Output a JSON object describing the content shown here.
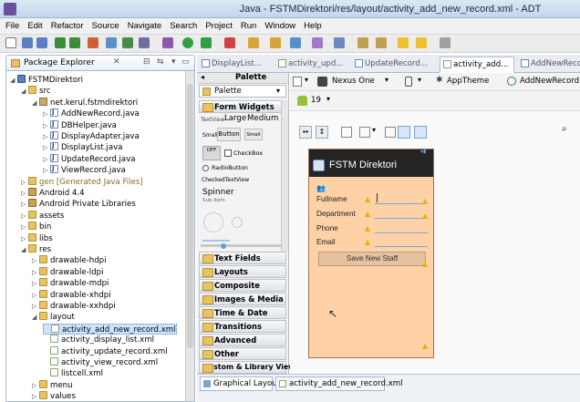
{
  "window": {
    "title": "Java - FSTMDirektori/res/layout/activity_add_new_record.xml - ADT"
  },
  "menu": [
    "File",
    "Edit",
    "Refactor",
    "Source",
    "Navigate",
    "Search",
    "Project",
    "Run",
    "Window",
    "Help"
  ],
  "package_explorer": {
    "title": "Package Explorer",
    "tree": [
      {
        "label": "FSTMDirektori",
        "icon": "project-icon",
        "depth": 0,
        "expanded": true
      },
      {
        "label": "src",
        "icon": "folder-icon",
        "depth": 1,
        "expanded": true
      },
      {
        "label": "net.kerul.fstmdirektori",
        "icon": "package-icon",
        "depth": 2,
        "expanded": true
      },
      {
        "label": "AddNewRecord.java",
        "icon": "java-file-icon",
        "depth": 3
      },
      {
        "label": "DBHelper.java",
        "icon": "java-file-icon",
        "depth": 3
      },
      {
        "label": "DisplayAdapter.java",
        "icon": "java-file-icon",
        "depth": 3
      },
      {
        "label": "DisplayList.java",
        "icon": "java-file-icon",
        "depth": 3
      },
      {
        "label": "UpdateRecord.java",
        "icon": "java-file-icon",
        "depth": 3
      },
      {
        "label": "ViewRecord.java",
        "icon": "java-file-icon",
        "depth": 3
      },
      {
        "label": "gen [Generated Java Files]",
        "icon": "folder-icon",
        "depth": 1,
        "muted": true
      },
      {
        "label": "Android 4.4",
        "icon": "library-icon",
        "depth": 1
      },
      {
        "label": "Android Private Libraries",
        "icon": "library-icon",
        "depth": 1
      },
      {
        "label": "assets",
        "icon": "folder-icon",
        "depth": 1
      },
      {
        "label": "bin",
        "icon": "folder-icon",
        "depth": 1
      },
      {
        "label": "libs",
        "icon": "folder-icon",
        "depth": 1
      },
      {
        "label": "res",
        "icon": "folder-icon",
        "depth": 1,
        "expanded": true
      },
      {
        "label": "drawable-hdpi",
        "icon": "folder-icon",
        "depth": 2
      },
      {
        "label": "drawable-ldpi",
        "icon": "folder-icon",
        "depth": 2
      },
      {
        "label": "drawable-mdpi",
        "icon": "folder-icon",
        "depth": 2
      },
      {
        "label": "drawable-xhdpi",
        "icon": "folder-icon",
        "depth": 2
      },
      {
        "label": "drawable-xxhdpi",
        "icon": "folder-icon",
        "depth": 2
      },
      {
        "label": "layout",
        "icon": "folder-icon",
        "depth": 2,
        "expanded": true
      },
      {
        "label": "activity_add_new_record.xml",
        "icon": "xml-file-icon",
        "depth": 3,
        "selected": true
      },
      {
        "label": "activity_display_list.xml",
        "icon": "xml-file-icon",
        "depth": 3
      },
      {
        "label": "activity_update_record.xml",
        "icon": "xml-file-icon",
        "depth": 3
      },
      {
        "label": "activity_view_record.xml",
        "icon": "xml-file-icon",
        "depth": 3
      },
      {
        "label": "listcell.xml",
        "icon": "xml-file-icon",
        "depth": 3
      },
      {
        "label": "menu",
        "icon": "folder-icon",
        "depth": 2
      },
      {
        "label": "values",
        "icon": "folder-icon",
        "depth": 2
      }
    ]
  },
  "editor_tabs": [
    {
      "label": "DisplayList..."
    },
    {
      "label": "activity_upd..."
    },
    {
      "label": "UpdateRecord..."
    },
    {
      "label": "activity_add...",
      "active": true
    },
    {
      "label": "AddNewRecor..."
    }
  ],
  "palette": {
    "title": "Palette",
    "dropdown": "Palette",
    "form_widgets": "Form Widgets",
    "textview_label": "TextView",
    "large": "Large",
    "medium": "Medium",
    "small": "Small",
    "button": "Button",
    "small_btn": "Small",
    "toggle": "OFF",
    "checkbox": "CheckBox",
    "radio": "RadioButton",
    "checked_tv": "CheckedTextView",
    "spinner": "Spinner",
    "spinner_sub": "Sub Item",
    "sections": [
      "Text Fields",
      "Layouts",
      "Composite",
      "Images & Media",
      "Time & Date",
      "Transitions",
      "Advanced",
      "Other",
      "Custom & Library Views"
    ]
  },
  "layout_toolbar": {
    "device": "Nexus One",
    "theme": "AppTheme",
    "activity": "AddNewRecord",
    "api": "19"
  },
  "phone": {
    "app_title": "FSTM Direktori",
    "fields": [
      "Fullname",
      "Department",
      "Phone",
      "Email"
    ],
    "button": "Save New Staff"
  },
  "bottom_tabs": [
    {
      "label": "Graphical Layout",
      "active": true
    },
    {
      "label": "activity_add_new_record.xml"
    }
  ]
}
